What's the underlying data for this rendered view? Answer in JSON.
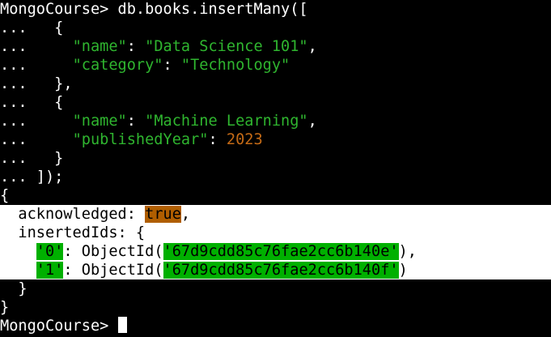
{
  "terminal": {
    "prompt": "MongoCourse> ",
    "continuation": "... ",
    "colors": {
      "background": "#000000",
      "text": "#ffffff",
      "string": "#2fb52f",
      "number": "#c46a16",
      "highlight_bg": "#ffffff",
      "bool_highlight": "#b05e00",
      "match_highlight": "#00b000"
    },
    "command": {
      "call": "db.books.insertMany([",
      "doc1_open": "  {",
      "doc1_name_key": "\"name\"",
      "doc1_name_value": "\"Data Science 101\"",
      "doc1_category_key": "\"category\"",
      "doc1_category_value": "\"Technology\"",
      "doc1_close": "  },",
      "doc2_open": "  {",
      "doc2_name_key": "\"name\"",
      "doc2_name_value": "\"Machine Learning\"",
      "doc2_year_key": "\"publishedYear\"",
      "doc2_year_value": "2023",
      "doc2_close": "  }",
      "end": "]);"
    },
    "result": {
      "open": "{",
      "ack_key": "acknowledged",
      "ack_value": "true",
      "ids_key": "insertedIds",
      "ids": [
        {
          "index": "'0'",
          "func": "ObjectId",
          "value": "'67d9cdd85c76fae2cc6b140e'"
        },
        {
          "index": "'1'",
          "func": "ObjectId",
          "value": "'67d9cdd85c76fae2cc6b140f'"
        }
      ],
      "ids_close": "}",
      "close": "}"
    },
    "cursor_icon": "block-cursor-icon"
  }
}
